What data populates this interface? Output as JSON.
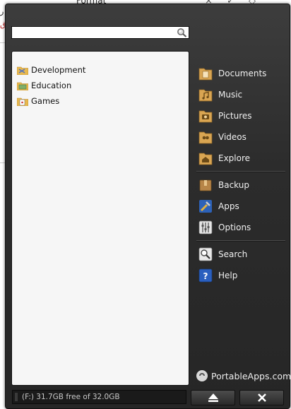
{
  "background": {
    "title": "Format",
    "controls": "× ✓ ◇",
    "rtl_fragment_1": "ر",
    "rtl_fragment_2": "ق"
  },
  "search": {
    "value": "",
    "placeholder": ""
  },
  "tree": {
    "items": [
      {
        "label": "Development",
        "icon": "folder-development-icon"
      },
      {
        "label": "Education",
        "icon": "folder-education-icon"
      },
      {
        "label": "Games",
        "icon": "folder-games-icon"
      }
    ]
  },
  "sidebar": {
    "group1": [
      {
        "label": "Documents",
        "icon": "documents-folder-icon"
      },
      {
        "label": "Music",
        "icon": "music-folder-icon"
      },
      {
        "label": "Pictures",
        "icon": "pictures-folder-icon"
      },
      {
        "label": "Videos",
        "icon": "videos-folder-icon"
      },
      {
        "label": "Explore",
        "icon": "explore-folder-icon"
      }
    ],
    "group2": [
      {
        "label": "Backup",
        "icon": "backup-icon"
      },
      {
        "label": "Apps",
        "icon": "apps-icon"
      },
      {
        "label": "Options",
        "icon": "options-icon"
      }
    ],
    "group3": [
      {
        "label": "Search",
        "icon": "search-magnifier-icon"
      },
      {
        "label": "Help",
        "icon": "help-icon"
      }
    ]
  },
  "brand": {
    "label": "PortableApps.com"
  },
  "drive": {
    "label": "(F:) 31.7GB free of 32.0GB",
    "used_fraction": 0.01
  },
  "colors": {
    "accent_folder": "#e8b25a",
    "panel_bg": "#2c2c2c",
    "help_blue": "#2a5fbf"
  }
}
